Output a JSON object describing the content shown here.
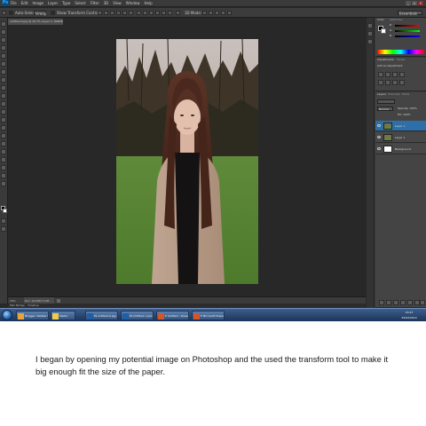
{
  "app": {
    "logo": "Ps",
    "menus": [
      "File",
      "Edit",
      "Image",
      "Layer",
      "Type",
      "Select",
      "Filter",
      "3D",
      "View",
      "Window",
      "Help"
    ],
    "window_controls": [
      "_",
      "▫",
      "×"
    ]
  },
  "options_bar": {
    "auto_select_label": "Auto-Select:",
    "auto_select_value": "Group",
    "transform_controls_label": "Show Transform Controls",
    "mode_3d_label": "3D Mode:",
    "workspace": "Essentials"
  },
  "document": {
    "tab_label": "untitled-0.jpg @ 16.7% (Layer 1, RGB/8)",
    "zoom": "16%",
    "doc_size": "Doc: 24.9M/7.12M"
  },
  "bottom_tabs": [
    "Mini Bridge",
    "Timeline"
  ],
  "panels": {
    "color_tabs": [
      "Color",
      "Swatches"
    ],
    "color_sliders": [
      "R",
      "G",
      "B"
    ],
    "adjustments_tabs": [
      "Adjustments",
      "Styles"
    ],
    "adjustments_title": "Add an adjustment",
    "layers_tabs": [
      "Layers",
      "Channels",
      "Paths"
    ],
    "blend_mode": "Normal",
    "opacity_label": "Opacity: 100%",
    "fill_label": "Fill: 100%",
    "layers": [
      {
        "name": "Layer 1",
        "selected": true
      },
      {
        "name": "Layer 1",
        "selected": false
      },
      {
        "name": "Background",
        "selected": false
      }
    ]
  },
  "taskbar": {
    "items": [
      {
        "label": "Blogger: Natalie S...",
        "icon_color": "#e8a33a"
      },
      {
        "label": "Media",
        "icon_color": "#f3c948"
      },
      {
        "label": "Ps  untitled-0.jpg...",
        "icon_color": "#1f5fa8"
      },
      {
        "label": "Ps  Untitled-1.psd...",
        "icon_color": "#1f5fa8"
      },
      {
        "label": "P  Untitled - Power...",
        "icon_color": "#d2562b"
      },
      {
        "label": "P  Microsoft Power...",
        "icon_color": "#d2562b"
      }
    ],
    "clock_time": "15:27",
    "clock_date": "25/02/2014"
  },
  "caption": "I began by opening my potential image on Photoshop and the used the transform tool to make it big enough fit the size of the paper.",
  "colors": {
    "ui_bg": "#3a3a3a",
    "canvas_bg": "#282828",
    "selected_layer": "#2f6fa8",
    "taskbar": "#2a4a78"
  }
}
